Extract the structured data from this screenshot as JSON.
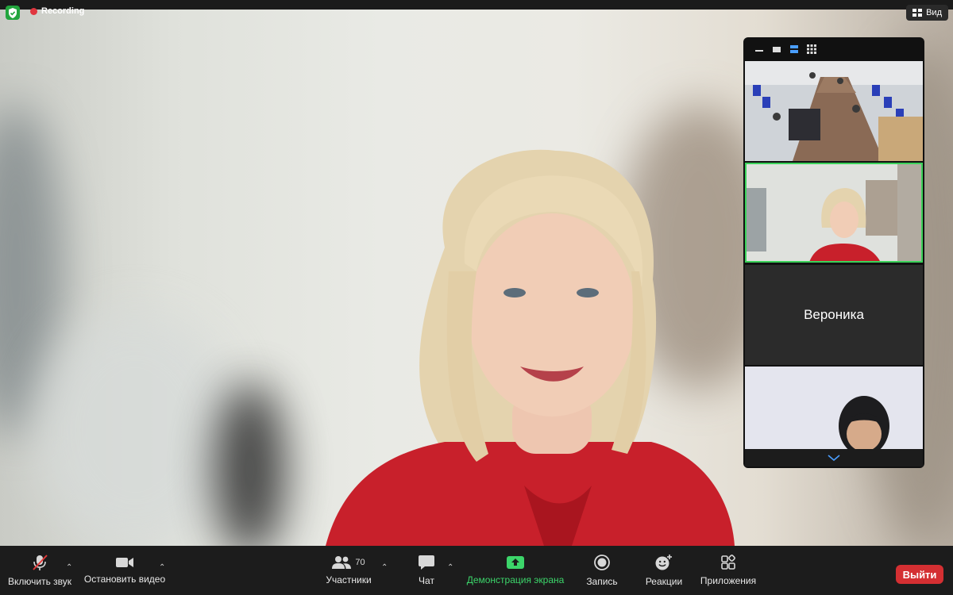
{
  "status": {
    "recording_label": "Recording",
    "view_label": "Вид"
  },
  "panel": {
    "tiles": [
      {
        "kind": "video",
        "description_icon": "classroom-video"
      },
      {
        "kind": "video",
        "active_speaker": true
      },
      {
        "kind": "name",
        "name": "Вероника"
      },
      {
        "kind": "video"
      }
    ]
  },
  "toolbar": {
    "unmute_label": "Включить звук",
    "stop_video_label": "Остановить видео",
    "participants_label": "Участники",
    "participants_count": "70",
    "chat_label": "Чат",
    "share_label": "Демонстрация экрана",
    "record_label": "Запись",
    "reactions_label": "Реакции",
    "apps_label": "Приложения",
    "leave_label": "Выйти"
  },
  "colors": {
    "share_green": "#3cd56a",
    "leave_red": "#d42f32",
    "speaker_border": "#3bd25a",
    "recording_red": "#e0363f"
  }
}
